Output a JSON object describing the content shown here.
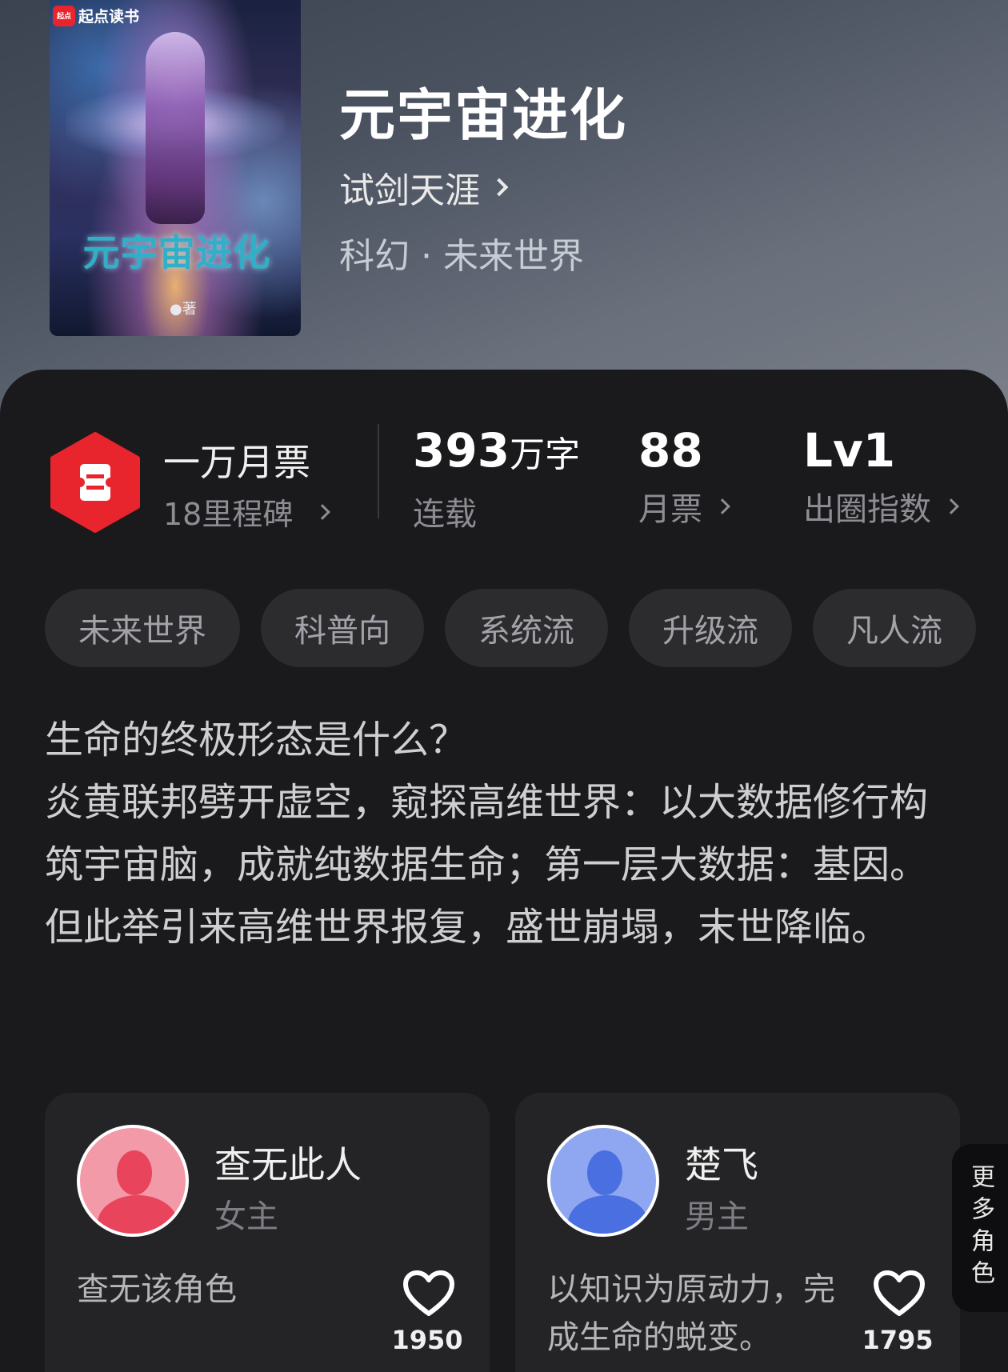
{
  "book": {
    "cover_badge": "起点读书",
    "cover_badge_mark": "起点",
    "cover_title": "元宇宙进化",
    "cover_author_suffix": "●著",
    "title": "元宇宙进化",
    "author": "试剑天涯",
    "genre": "科幻 · 未来世界"
  },
  "stats": {
    "ticket_title": "一万月票",
    "ticket_sub": "18里程碑",
    "words_value": "393",
    "words_unit": "万字",
    "words_label": "连载",
    "monthly_value": "88",
    "monthly_label": "月票",
    "influence_value": "Lv1",
    "influence_label": "出圈指数"
  },
  "tags": [
    "未来世界",
    "科普向",
    "系统流",
    "升级流",
    "凡人流"
  ],
  "description": [
    "生命的终极形态是什么？",
    "炎黄联邦劈开虚空，窥探高维世界：以大数据修行构筑宇宙脑，成就纯数据生命；第一层大数据：基因。",
    "但此举引来高维世界报复，盛世崩塌，末世降临。"
  ],
  "characters": [
    {
      "name": "查无此人",
      "role": "女主",
      "desc": "查无该角色",
      "likes": "1950"
    },
    {
      "name": "楚飞",
      "role": "男主",
      "desc": "以知识为原动力，完成生命的蜕变。",
      "likes": "1795"
    }
  ],
  "more_roles": "更多角色",
  "colors": {
    "accent_red": "#e8242c",
    "female_avatar": "#f39aa8",
    "male_avatar": "#8fa6f0"
  }
}
